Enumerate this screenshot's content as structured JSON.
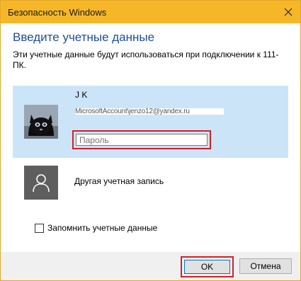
{
  "window": {
    "title": "Безопасность Windows"
  },
  "dialog": {
    "heading": "Введите учетные данные",
    "subtext": "Эти учетные данные будут использоваться при подключении к 111-ПК."
  },
  "account": {
    "name": "J K",
    "email": "MicrosoftAccount\\jenzo12@yandex.ru",
    "password_placeholder": "Пароль",
    "avatar_icon": "cat-avatar-icon"
  },
  "other_account": {
    "label": "Другая учетная запись",
    "icon": "user-icon"
  },
  "remember": {
    "label": "Запомнить учетные данные",
    "checked": false
  },
  "buttons": {
    "ok": "OK",
    "cancel": "Отмена"
  },
  "colors": {
    "titlebar": "#f5b728",
    "heading": "#1f4e9a",
    "selection": "#cce4f7",
    "highlight_frame": "#d21f2b"
  }
}
